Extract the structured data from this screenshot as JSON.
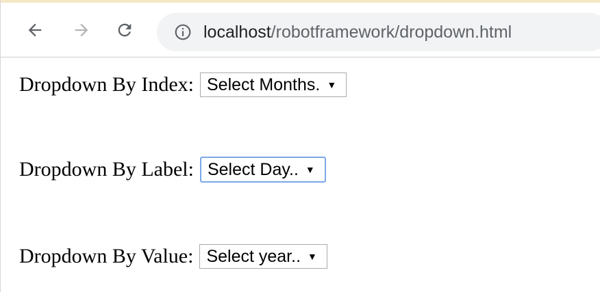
{
  "browser": {
    "address_bar": {
      "host": "localhost",
      "path": "/robotframework/dropdown.html"
    },
    "icons": {
      "back": "arrow-left-icon",
      "forward": "arrow-right-icon",
      "reload": "reload-icon",
      "info": "info-icon"
    }
  },
  "page": {
    "rows": [
      {
        "label": "Dropdown By Index:",
        "selected": "Select Months."
      },
      {
        "label": "Dropdown By Label:",
        "selected": "Select Day.."
      },
      {
        "label": "Dropdown By Value:",
        "selected": "Select year.."
      }
    ],
    "caret": "▼"
  }
}
